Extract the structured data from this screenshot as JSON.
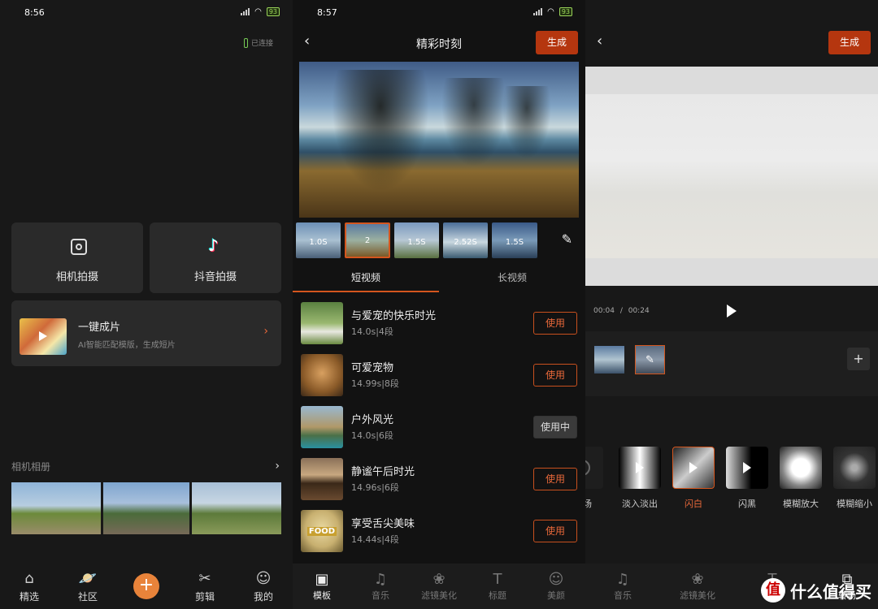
{
  "panel1": {
    "status_time": "8:56",
    "battery": "93",
    "connection": "已连接",
    "card_camera": "相机拍摄",
    "card_douyin": "抖音拍摄",
    "oneclick_title": "一键成片",
    "oneclick_sub": "AI智能匹配模版，生成短片",
    "album_title": "相机相册",
    "nav": [
      {
        "label": "精选",
        "icon": "home-icon"
      },
      {
        "label": "社区",
        "icon": "planet-icon"
      },
      {
        "label": "",
        "icon": "plus-icon"
      },
      {
        "label": "剪辑",
        "icon": "scissors-icon"
      },
      {
        "label": "我的",
        "icon": "user-icon"
      }
    ]
  },
  "panel2": {
    "status_time": "8:57",
    "battery": "93",
    "title": "精彩时刻",
    "generate": "生成",
    "clips": [
      "1.0S",
      "2",
      "1.5S",
      "2.52S",
      "1.5S"
    ],
    "tab_short": "短视频",
    "tab_long": "长视频",
    "templates": [
      {
        "name": "与爱宠的快乐时光",
        "meta": "14.0s|4段",
        "action": "使用"
      },
      {
        "name": "可爱宠物",
        "meta": "14.99s|8段",
        "action": "使用"
      },
      {
        "name": "户外风光",
        "meta": "14.0s|6段",
        "action": "使用中"
      },
      {
        "name": "静谧午后时光",
        "meta": "14.96s|6段",
        "action": "使用"
      },
      {
        "name": "享受舌尖美味",
        "meta": "14.44s|4段",
        "action": "使用"
      }
    ],
    "food_text": "FOOD",
    "tabs": [
      "模板",
      "音乐",
      "滤镜美化",
      "标题",
      "美颜"
    ]
  },
  "panel3": {
    "generate": "生成",
    "time_current": "00:04",
    "time_sep": "/",
    "time_total": "00:24",
    "effects": [
      "转场",
      "淡入淡出",
      "闪白",
      "闪黑",
      "模糊放大",
      "模糊缩小"
    ],
    "tabs": [
      "音乐",
      "滤镜美化",
      "标题",
      "转场"
    ],
    "watermark": "什么值得买"
  },
  "colors": {
    "accent": "#b5360f",
    "accent_text": "#e8683a",
    "bg": "#181818"
  }
}
